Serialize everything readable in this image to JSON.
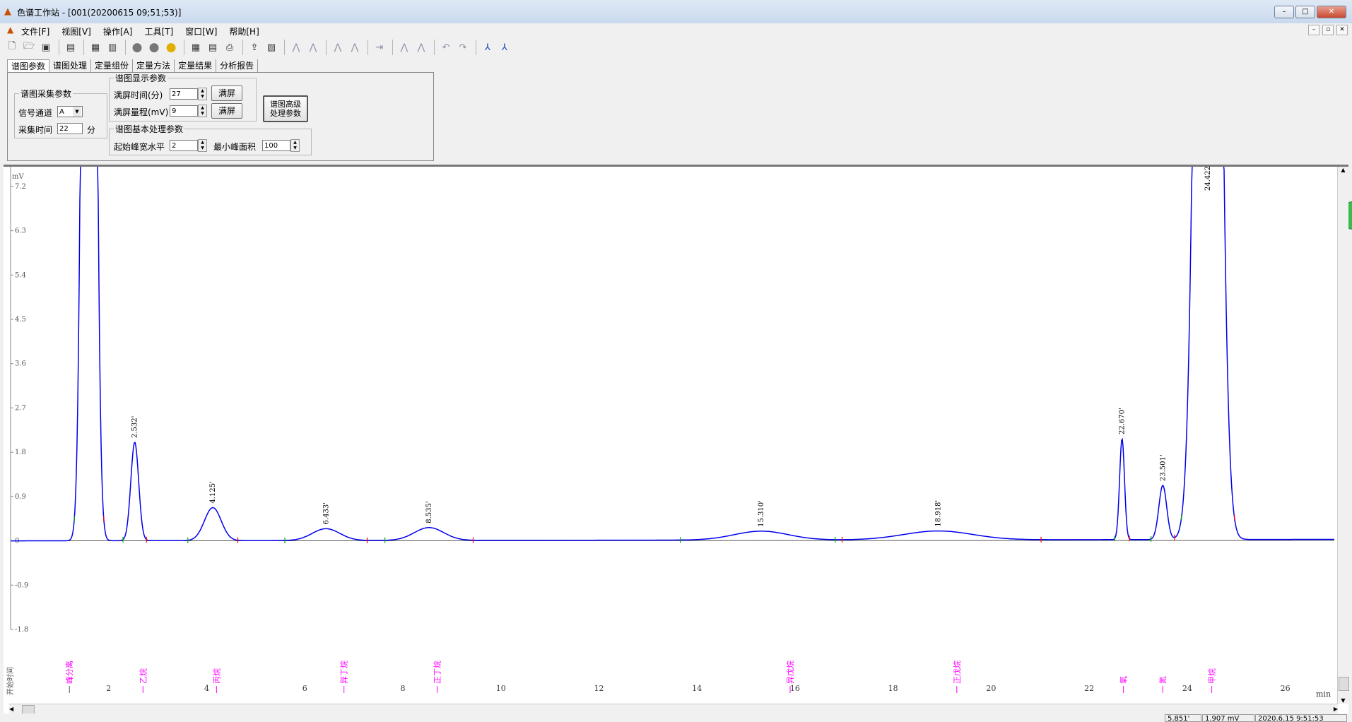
{
  "window": {
    "title": "色谱工作站 - [001(20200615 09;51;53)]",
    "minimize": "–",
    "maximize": "□",
    "close": "✕"
  },
  "menu": [
    "文件[F]",
    "视图[V]",
    "操作[A]",
    "工具[T]",
    "窗口[W]",
    "帮助[H]"
  ],
  "mdi_controls": [
    "–",
    "▫",
    "✕"
  ],
  "toolbar_icons": [
    "new-file-icon",
    "open-folder-icon",
    "save-icon",
    "import-icon",
    "method-icon",
    "calibrate-icon",
    "record-start-icon",
    "record-stop-icon",
    "zero-icon",
    "calculator-icon",
    "report-icon",
    "print-icon",
    "export-icon",
    "export-data-icon",
    "peak-mark-icon",
    "peak-split-icon",
    "baseline-icon",
    "baseline-drop-icon",
    "arrow-right-icon",
    "compare-icon",
    "overlay-icon",
    "undo-icon",
    "redo-icon",
    "peak-pick-icon",
    "peak-pair-icon"
  ],
  "tabs": [
    "谱图参数",
    "谱图处理",
    "定量组份",
    "定量方法",
    "定量结果",
    "分析报告"
  ],
  "acquisition": {
    "title": "谱图采集参数",
    "channel_label": "信号通道",
    "channel_value": "A",
    "time_label": "采集时间",
    "time_value": "22",
    "time_unit": "分"
  },
  "display": {
    "title": "谱图显示参数",
    "fullscreen_time_label": "满屏时间(分)",
    "fullscreen_time_value": "27",
    "fullscreen_range_label": "满屏量程(mV)",
    "fullscreen_range_value": "9",
    "fullscreen_button": "满屏",
    "advanced_button_line1": "谱图高级",
    "advanced_button_line2": "处理参数"
  },
  "basic": {
    "title": "谱图基本处理参数",
    "start_width_label": "起始峰宽水平",
    "start_width_value": "2",
    "min_area_label": "最小峰面积",
    "min_area_value": "100"
  },
  "chart_data": {
    "type": "line",
    "xlabel": "min",
    "ylabel": "mV",
    "xlim": [
      0,
      27
    ],
    "ylim": [
      -1.8,
      7.6
    ],
    "x_ticks": [
      "2",
      "4",
      "6",
      "8",
      "10",
      "12",
      "14",
      "16",
      "18",
      "20",
      "22",
      "24",
      "26"
    ],
    "y_ticks": [
      "7.2",
      "6.3",
      "5.4",
      "4.5",
      "3.6",
      "2.7",
      "1.8",
      "0.9",
      "0",
      "-0.9",
      "-1.8"
    ],
    "series": [
      {
        "color": "#0000ee",
        "peaks": [
          {
            "t": 1.6,
            "h": 40,
            "w": 0.1
          },
          {
            "t": 2.532,
            "h": 2.0,
            "w": 0.08
          },
          {
            "t": 4.125,
            "h": 0.67,
            "w": 0.17
          },
          {
            "t": 6.433,
            "h": 0.24,
            "w": 0.28
          },
          {
            "t": 8.535,
            "h": 0.26,
            "w": 0.3
          },
          {
            "t": 15.31,
            "h": 0.18,
            "w": 0.55
          },
          {
            "t": 18.918,
            "h": 0.18,
            "w": 0.7
          },
          {
            "t": 22.67,
            "h": 2.05,
            "w": 0.05
          },
          {
            "t": 23.501,
            "h": 1.1,
            "w": 0.08
          },
          {
            "t": 24.422,
            "h": 40,
            "w": 0.18
          }
        ]
      }
    ],
    "peak_labels": [
      {
        "t": 2.532,
        "label": "2.532'"
      },
      {
        "t": 4.125,
        "label": "4.125'"
      },
      {
        "t": 6.433,
        "label": "6.433'"
      },
      {
        "t": 8.535,
        "label": "8.535'"
      },
      {
        "t": 15.31,
        "label": "15.310'"
      },
      {
        "t": 18.918,
        "label": "18.918'"
      },
      {
        "t": 22.67,
        "label": "22.670'"
      },
      {
        "t": 23.501,
        "label": "23.501'"
      },
      {
        "t": 24.422,
        "label": "24.422'"
      }
    ],
    "components": [
      {
        "t": 1.2,
        "name": "峰分离",
        "color": "#555555"
      },
      {
        "t": 2.7,
        "name": "乙烷",
        "color": "#ff00ff"
      },
      {
        "t": 4.2,
        "name": "丙烷",
        "color": "#ff00ff"
      },
      {
        "t": 6.8,
        "name": "异丁烷",
        "color": "#ff00ff"
      },
      {
        "t": 8.7,
        "name": "正丁烷",
        "color": "#ff00ff"
      },
      {
        "t": 15.9,
        "name": "异戊烷",
        "color": "#ff00ff"
      },
      {
        "t": 19.3,
        "name": "正戊烷",
        "color": "#ff00ff"
      },
      {
        "t": 22.7,
        "name": "氧",
        "color": "#ff00ff"
      },
      {
        "t": 23.5,
        "name": "氮",
        "color": "#ff00ff"
      },
      {
        "t": 24.5,
        "name": "甲烷",
        "color": "#ff00ff"
      }
    ],
    "left_vertical_label": "开始时间",
    "baseline_color": "#555555",
    "marker_colors": {
      "start": "#00aa00",
      "end": "#ff0000"
    }
  },
  "status": {
    "time": "5.851'",
    "signal": "1.907 mV",
    "datetime": "2020.6.15 9:51:53"
  }
}
